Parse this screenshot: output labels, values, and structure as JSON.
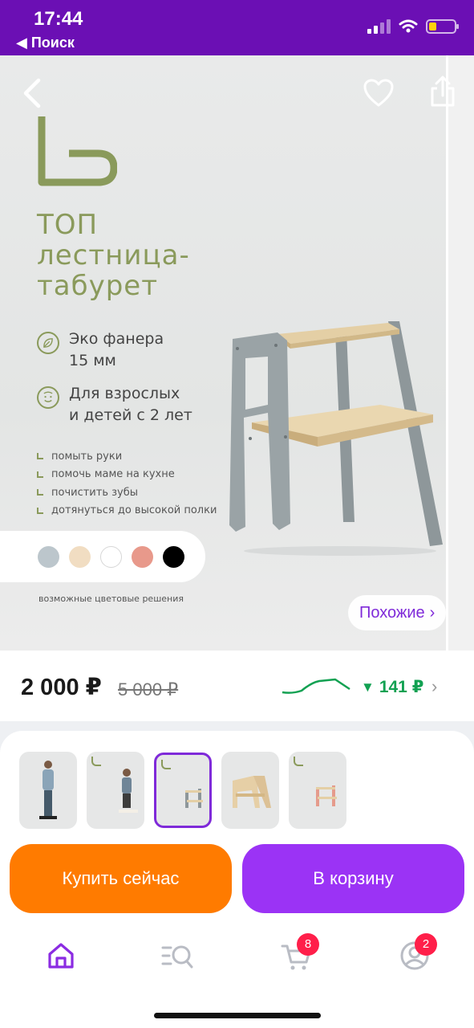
{
  "status": {
    "time": "17:44",
    "back_label": "◀ Поиск"
  },
  "gallery": {
    "headline": [
      "ТОП",
      "лестница-",
      "табурет"
    ],
    "features": [
      {
        "line1": "Эко фанера",
        "line2": "15 мм",
        "icon": "leaf-icon"
      },
      {
        "line1": "Для взрослых",
        "line2": "и детей с 2 лет",
        "icon": "child-face-icon"
      }
    ],
    "bullets": [
      "помыть руки",
      "помочь маме на кухне",
      "почистить зубы",
      "дотянуться до высокой полки"
    ],
    "swatch_colors": [
      "#bcc6cc",
      "#f1ddc2",
      "#ffffff",
      "#e8998b",
      "#000000"
    ],
    "swatch_caption": "возможные цветовые решения",
    "similar_label": "Похожие",
    "similar_chevron": "›"
  },
  "price": {
    "current": "2 000 ₽",
    "old": "5 000 ₽",
    "drop_arrow": "▼",
    "drop_amount": "141 ₽",
    "chevron": "›"
  },
  "thumbnails": [
    {
      "name": "photo-adult-child",
      "selected": false
    },
    {
      "name": "photo-child-on-stool",
      "selected": false
    },
    {
      "name": "photo-gray-stool",
      "selected": true
    },
    {
      "name": "photo-natural-stool",
      "selected": false
    },
    {
      "name": "photo-pink-stool",
      "selected": false
    }
  ],
  "actions": {
    "buy_now": "Купить сейчас",
    "add_to_cart": "В корзину"
  },
  "tabbar": {
    "items": [
      "home-icon",
      "catalog-search-icon",
      "cart-icon",
      "profile-icon"
    ],
    "cart_badge": "8",
    "profile_badge": "2"
  },
  "colors": {
    "brand_purple": "#6b0fb4",
    "accent_orange": "#ff7b00",
    "accent_violet": "#9b33f5",
    "olive": "#8a9a5b",
    "price_green": "#12a152"
  }
}
